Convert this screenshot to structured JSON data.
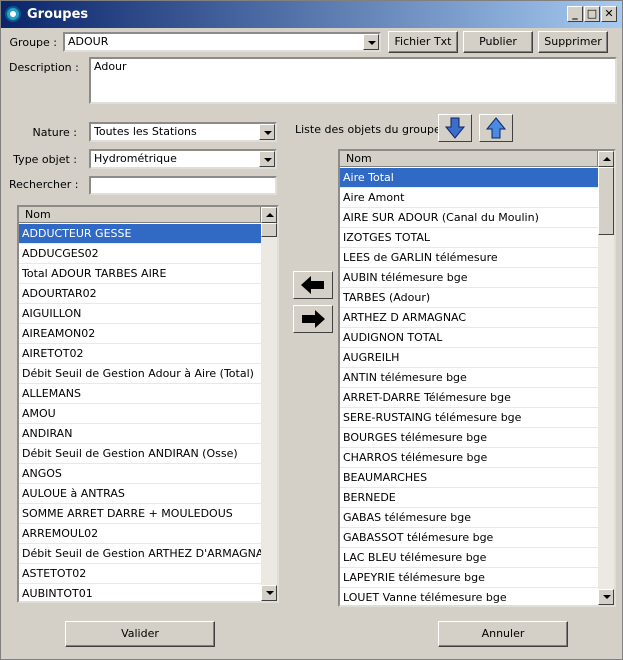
{
  "window": {
    "title": "Groupes",
    "controls": {
      "minimize": "_",
      "maximize": "□",
      "close": "✕"
    }
  },
  "form": {
    "groupe_label": "Groupe :",
    "groupe_value": "ADOUR",
    "description_label": "Description :",
    "description_value": "Adour",
    "nature_label": "Nature :",
    "nature_value": "Toutes les Stations",
    "type_label": "Type objet :",
    "type_value": "Hydrométrique",
    "search_label": "Rechercher :",
    "search_value": ""
  },
  "toolbar": {
    "fichier_txt": "Fichier Txt",
    "publier": "Publier",
    "supprimer": "Supprimer"
  },
  "group_list_label": "Liste des objets du groupe",
  "left_list": {
    "header": "Nom",
    "items": [
      "ADDUCTEUR GESSE",
      "ADDUCGES02",
      "Total ADOUR TARBES AIRE",
      "ADOURTAR02",
      "AIGUILLON",
      "AIREAMON02",
      "AIRETOT02",
      "Débit Seuil de Gestion Adour à Aire (Total)",
      "ALLEMANS",
      "AMOU",
      "ANDIRAN",
      "Débit Seuil de Gestion ANDIRAN (Osse)",
      "ANGOS",
      "AULOUE à ANTRAS",
      "SOMME ARRET DARRE + MOULEDOUS",
      "ARREMOUL02",
      "Débit Seuil de Gestion ARTHEZ D'ARMAGNA...",
      "ASTETOT02",
      "AUBINTOT01"
    ],
    "selected_index": 0
  },
  "right_list": {
    "header": "Nom",
    "items": [
      "Aire Total",
      "Aire Amont",
      "AIRE SUR ADOUR (Canal du Moulin)",
      "IZOTGES TOTAL",
      "LEES de GARLIN télémesure",
      "AUBIN télémesure bge",
      "TARBES (Adour)",
      "ARTHEZ D ARMAGNAC",
      "AUDIGNON TOTAL",
      "AUGREILH",
      "ANTIN télémesure bge",
      "ARRET-DARRE Télémesure bge",
      "SERE-RUSTAING télémesure bge",
      "BOURGES télémesure bge",
      "CHARROS télémesure bge",
      "BEAUMARCHES",
      "BERNEDE",
      "GABAS télémesure bge",
      "GABASSOT télémesure bge",
      "LAC BLEU télémesure bge",
      "LAPEYRIE télémesure bge",
      "LOUET Vanne télémesure bge"
    ],
    "selected_index": 0
  },
  "buttons": {
    "valider": "Valider",
    "annuler": "Annuler"
  },
  "colors": {
    "selection": "#316ac5",
    "titlebar": "#0a246a",
    "face": "#d4d0c8"
  }
}
